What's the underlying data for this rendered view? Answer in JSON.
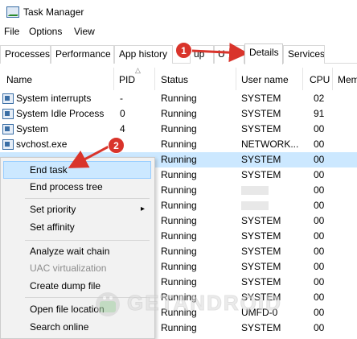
{
  "window": {
    "title": "Task Manager"
  },
  "menubar": {
    "items": [
      "File",
      "Options",
      "View"
    ]
  },
  "tabs": [
    {
      "label": "Processes"
    },
    {
      "label": "Performance"
    },
    {
      "label": "App history"
    },
    {
      "label": "up"
    },
    {
      "label": "U"
    },
    {
      "label": "Details",
      "active": true
    },
    {
      "label": "Services"
    }
  ],
  "columns": [
    "Name",
    "PID",
    "Status",
    "User name",
    "CPU",
    "Mem"
  ],
  "rows": [
    {
      "name": "System interrupts",
      "pid": "-",
      "status": "Running",
      "user": "SYSTEM",
      "cpu": "02"
    },
    {
      "name": "System Idle Process",
      "pid": "0",
      "status": "Running",
      "user": "SYSTEM",
      "cpu": "91"
    },
    {
      "name": "System",
      "pid": "4",
      "status": "Running",
      "user": "SYSTEM",
      "cpu": "00"
    },
    {
      "name": "svchost.exe",
      "pid": "",
      "status": "Running",
      "user": "NETWORK...",
      "cpu": "00"
    },
    {
      "name": "",
      "pid": "",
      "status": "Running",
      "user": "SYSTEM",
      "cpu": "00",
      "selected": true
    },
    {
      "name": "",
      "pid": "",
      "status": "Running",
      "user": "SYSTEM",
      "cpu": "00"
    },
    {
      "name": "",
      "pid": "",
      "status": "Running",
      "user": "",
      "cpu": "00",
      "redacted": true
    },
    {
      "name": "",
      "pid": "",
      "status": "Running",
      "user": "",
      "cpu": "00",
      "redacted": true
    },
    {
      "name": "",
      "pid": "",
      "status": "Running",
      "user": "SYSTEM",
      "cpu": "00"
    },
    {
      "name": "",
      "pid": "",
      "status": "Running",
      "user": "SYSTEM",
      "cpu": "00"
    },
    {
      "name": "",
      "pid": "",
      "status": "Running",
      "user": "SYSTEM",
      "cpu": "00"
    },
    {
      "name": "",
      "pid": "",
      "status": "Running",
      "user": "SYSTEM",
      "cpu": "00"
    },
    {
      "name": "",
      "pid": "",
      "status": "Running",
      "user": "SYSTEM",
      "cpu": "00"
    },
    {
      "name": "",
      "pid": "",
      "status": "Running",
      "user": "SYSTEM",
      "cpu": "00"
    },
    {
      "name": "",
      "pid": "",
      "status": "Running",
      "user": "UMFD-0",
      "cpu": "00"
    },
    {
      "name": "",
      "pid": "",
      "status": "Running",
      "user": "SYSTEM",
      "cpu": "00"
    }
  ],
  "context_menu": {
    "end_task": "End task",
    "end_process_tree": "End process tree",
    "set_priority": "Set priority",
    "set_affinity": "Set affinity",
    "analyze_wait_chain": "Analyze wait chain",
    "uac_virtualization": "UAC virtualization",
    "create_dump_file": "Create dump file",
    "open_file_location": "Open file location",
    "search_online": "Search online"
  },
  "badges": {
    "step1": "1",
    "step2": "2"
  },
  "watermark": {
    "text": "GETANDROID"
  },
  "colors": {
    "selection": "#cce8ff",
    "badge": "#d9342b",
    "arrow": "#d9342b"
  },
  "icons": [
    "task-manager-icon",
    "process-icon",
    "sort-up-icon",
    "chevron-right-icon",
    "callout-arrow-icon",
    "android-logo-icon"
  ]
}
